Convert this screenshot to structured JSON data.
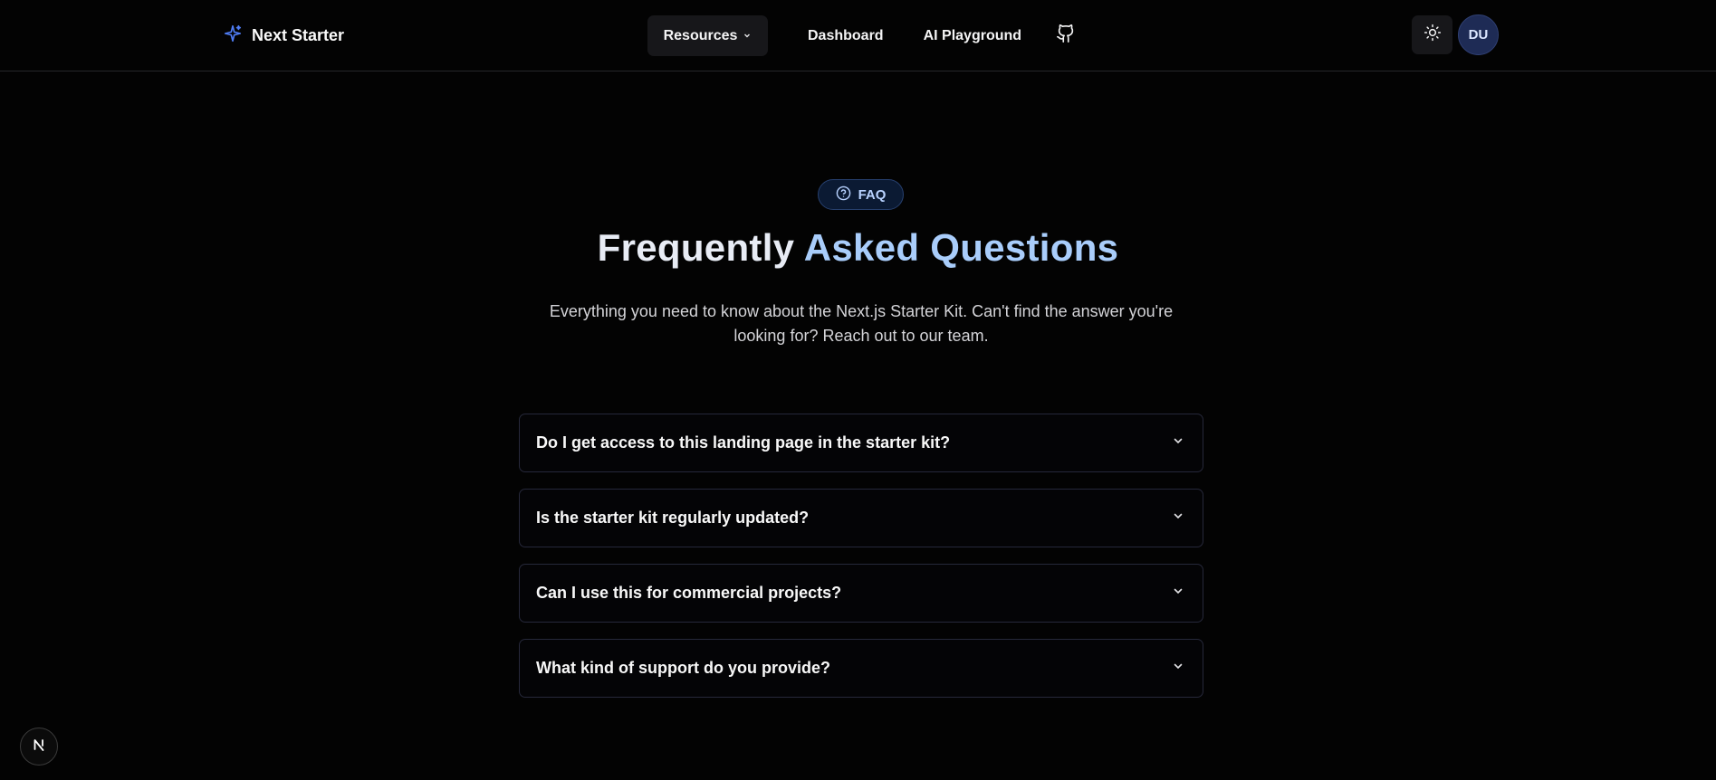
{
  "header": {
    "brand": "Next Starter",
    "brand_icon": "sparkles-icon",
    "nav": {
      "resources": "Resources",
      "dashboard": "Dashboard",
      "ai_playground": "AI Playground"
    },
    "github_icon": "github-icon",
    "theme_icon": "sun-icon",
    "avatar_initials": "DU"
  },
  "hero": {
    "badge": "FAQ",
    "title_part1": "Frequently",
    "title_part2": "Asked Questions",
    "subtitle": "Everything you need to know about the Next.js Starter Kit. Can't find the answer you're looking for? Reach out to our team."
  },
  "faq": {
    "items": [
      {
        "question": "Do I get access to this landing page in the starter kit?"
      },
      {
        "question": "Is the starter kit regularly updated?"
      },
      {
        "question": "Can I use this for commercial projects?"
      },
      {
        "question": "What kind of support do you provide?"
      }
    ]
  },
  "dev_badge": {
    "label": "N"
  },
  "colors": {
    "background": "#030303",
    "accent": "#a9cdfb",
    "brand_icon": "#4f7df5",
    "avatar_bg": "#1e2b55"
  }
}
